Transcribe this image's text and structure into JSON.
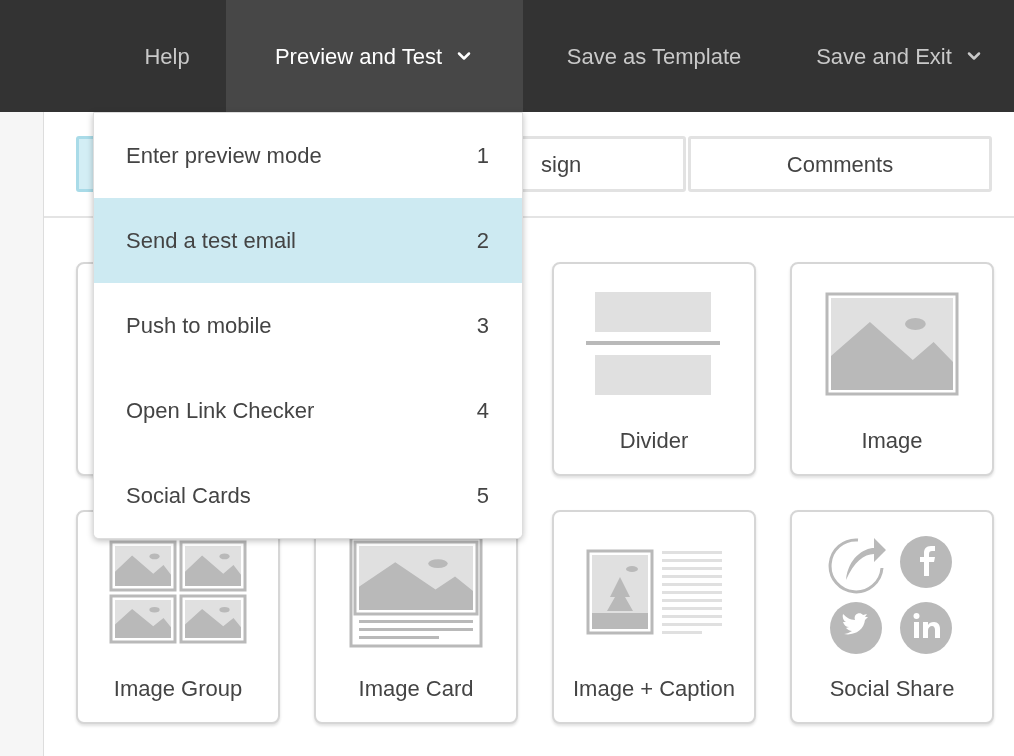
{
  "nav": {
    "items": [
      {
        "label": "Help",
        "selected": false,
        "has_caret": false
      },
      {
        "label": "Preview and Test",
        "selected": true,
        "has_caret": true
      },
      {
        "label": "Save as Template",
        "selected": false,
        "has_caret": false
      },
      {
        "label": "Save and Exit",
        "selected": false,
        "has_caret": true
      }
    ]
  },
  "tabs": [
    {
      "selected": true
    },
    {
      "label": "sign",
      "selected": false
    },
    {
      "label": "Comments",
      "selected": false
    }
  ],
  "blocks": [
    {
      "kind": "covered"
    },
    {
      "kind": "divider",
      "label": "Divider"
    },
    {
      "kind": "image",
      "label": "Image"
    },
    {
      "kind": "image_group",
      "label": "Image Group"
    },
    {
      "kind": "image_card",
      "label": "Image Card"
    },
    {
      "kind": "image_caption",
      "label": "Image + Caption"
    },
    {
      "kind": "social_share",
      "label": "Social Share"
    }
  ],
  "menu": {
    "items": [
      {
        "label": "Enter preview mode",
        "shortcut": "1",
        "selected": false
      },
      {
        "label": "Send a test email",
        "shortcut": "2",
        "selected": true
      },
      {
        "label": "Push to mobile",
        "shortcut": "3",
        "selected": false
      },
      {
        "label": "Open Link Checker",
        "shortcut": "4",
        "selected": false
      },
      {
        "label": "Social Cards",
        "shortcut": "5",
        "selected": false
      }
    ]
  }
}
